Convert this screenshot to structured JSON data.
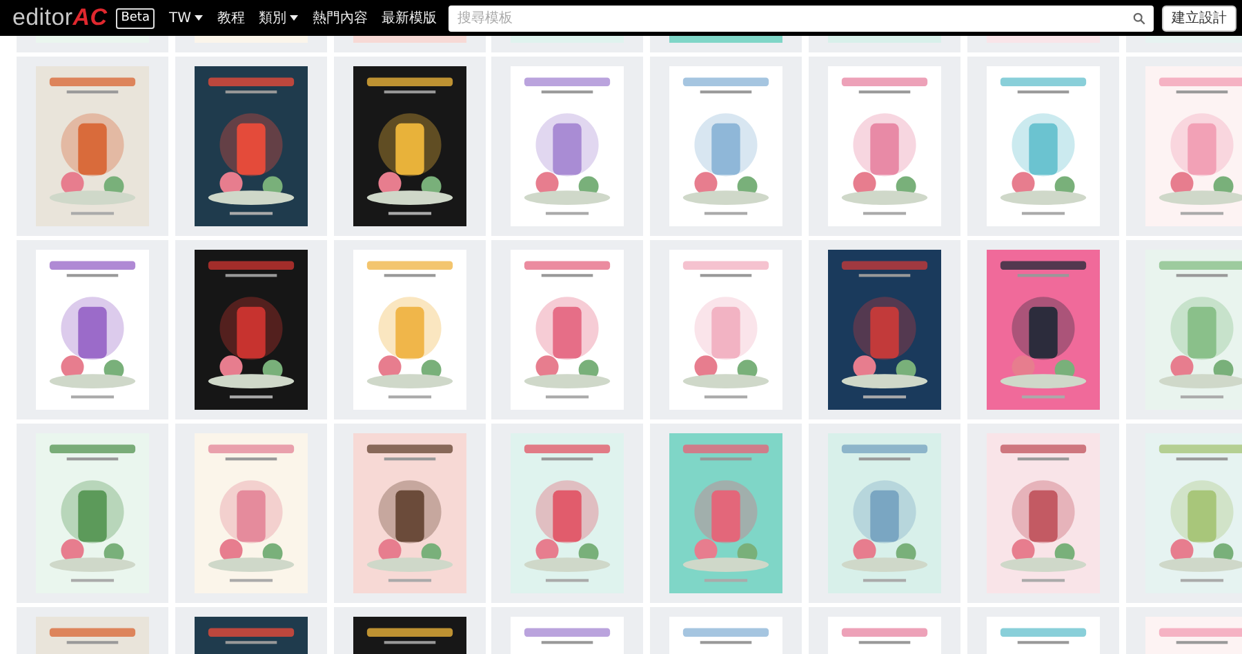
{
  "header": {
    "logo": {
      "text": "editor",
      "accent": "AC"
    },
    "badge": "Beta",
    "nav": [
      {
        "label": "TW",
        "dropdown": true
      },
      {
        "label": "教程",
        "dropdown": false
      },
      {
        "label": "類別",
        "dropdown": true
      },
      {
        "label": "熱門內容",
        "dropdown": false
      },
      {
        "label": "最新模版",
        "dropdown": false
      }
    ],
    "search": {
      "placeholder": "搜尋模板"
    },
    "create_button": "建立設計"
  }
}
